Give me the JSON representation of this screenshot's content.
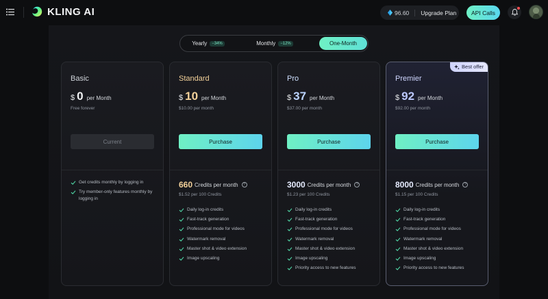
{
  "header": {
    "brand": "KLING AI",
    "credits_amount": "96.60",
    "upgrade_label": "Upgrade Plan",
    "api_label": "API Calls",
    "icons": [
      "menu-icon",
      "logo-icon",
      "gem-icon",
      "bell-icon",
      "avatar"
    ]
  },
  "toggle": {
    "options": [
      {
        "label": "Yearly",
        "badge": "−34%"
      },
      {
        "label": "Monthly",
        "badge": "−12%"
      },
      {
        "label": "One-Month",
        "badge": ""
      }
    ],
    "selected": "One-Month"
  },
  "plans": [
    {
      "name": "Basic",
      "currency": "$",
      "price": "0",
      "per": "per Month",
      "subprice": "Free forever",
      "cta": "Current",
      "features": [
        "Get credits monthly by logging in",
        "Try member-only features monthly by logging in"
      ]
    },
    {
      "name": "Standard",
      "currency": "$",
      "price": "10",
      "per": "per Month",
      "subprice": "$10.00 per month",
      "cta": "Purchase",
      "credits": "660",
      "credits_label": "Credits per month",
      "per_credits": "$1.52 per 100 Credits",
      "features": [
        "Daily log-in credits",
        "Fast-track generation",
        "Professional mode for videos",
        "Watermark removal",
        "Master shot & video extension",
        "Image upscaling"
      ]
    },
    {
      "name": "Pro",
      "currency": "$",
      "price": "37",
      "per": "per Month",
      "subprice": "$37.00 per month",
      "cta": "Purchase",
      "credits": "3000",
      "credits_label": "Credits per month",
      "per_credits": "$1.23 per 100 Credits",
      "features": [
        "Daily log-in credits",
        "Fast-track generation",
        "Professional mode for videos",
        "Watermark removal",
        "Master shot & video extension",
        "Image upscaling",
        "Priority access to new features"
      ]
    },
    {
      "name": "Premier",
      "badge": "Best offer",
      "currency": "$",
      "price": "92",
      "per": "per Month",
      "subprice": "$92.00 per month",
      "cta": "Purchase",
      "credits": "8000",
      "credits_label": "Credits per month",
      "per_credits": "$1.15 per 100 Credits",
      "features": [
        "Daily log-in credits",
        "Fast-track generation",
        "Professional mode for videos",
        "Watermark removal",
        "Master shot & video extension",
        "Image upscaling",
        "Priority access to new features"
      ]
    }
  ],
  "colors": {
    "accent_start": "#6ff0c4",
    "accent_end": "#5dd4ec",
    "background": "#0d0e10",
    "check": "#4fd8a6"
  }
}
